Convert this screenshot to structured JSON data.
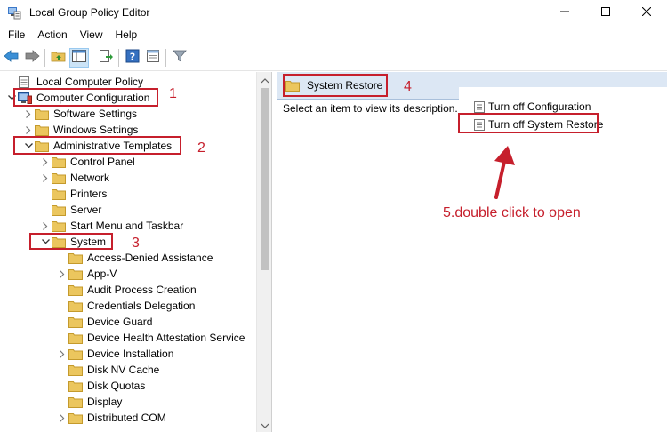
{
  "window": {
    "title": "Local Group Policy Editor",
    "app_icon": "group-policy-icon",
    "controls": [
      "minimize-icon",
      "maximize-icon",
      "close-icon"
    ]
  },
  "menubar": {
    "items": [
      {
        "label": "File"
      },
      {
        "label": "Action"
      },
      {
        "label": "View"
      },
      {
        "label": "Help"
      }
    ]
  },
  "toolbar": {
    "buttons": [
      "back-arrow-icon",
      "forward-arrow-icon",
      "up-folder-icon",
      "show-hide-tree-icon",
      "export-list-icon",
      "help-icon",
      "properties-icon",
      "filter-icon"
    ]
  },
  "tree": {
    "items": [
      {
        "label": "Local Computer Policy",
        "level": 0,
        "expander": "",
        "icon": "policy-root-icon"
      },
      {
        "label": "Computer Configuration",
        "level": 0,
        "expander": "expanded",
        "icon": "computer-icon"
      },
      {
        "label": "Software Settings",
        "level": 1,
        "expander": "collapsed",
        "icon": "folder-icon"
      },
      {
        "label": "Windows Settings",
        "level": 1,
        "expander": "collapsed",
        "icon": "folder-icon"
      },
      {
        "label": "Administrative Templates",
        "level": 1,
        "expander": "expanded",
        "icon": "folder-icon"
      },
      {
        "label": "Control Panel",
        "level": 2,
        "expander": "collapsed",
        "icon": "folder-icon"
      },
      {
        "label": "Network",
        "level": 2,
        "expander": "collapsed",
        "icon": "folder-icon"
      },
      {
        "label": "Printers",
        "level": 2,
        "expander": "",
        "icon": "folder-icon"
      },
      {
        "label": "Server",
        "level": 2,
        "expander": "",
        "icon": "folder-icon"
      },
      {
        "label": "Start Menu and Taskbar",
        "level": 2,
        "expander": "collapsed",
        "icon": "folder-icon"
      },
      {
        "label": "System",
        "level": 2,
        "expander": "expanded",
        "icon": "folder-icon"
      },
      {
        "label": "Access-Denied Assistance",
        "level": 3,
        "expander": "",
        "icon": "folder-icon"
      },
      {
        "label": "App-V",
        "level": 3,
        "expander": "collapsed",
        "icon": "folder-icon"
      },
      {
        "label": "Audit Process Creation",
        "level": 3,
        "expander": "",
        "icon": "folder-icon"
      },
      {
        "label": "Credentials Delegation",
        "level": 3,
        "expander": "",
        "icon": "folder-icon"
      },
      {
        "label": "Device Guard",
        "level": 3,
        "expander": "",
        "icon": "folder-icon"
      },
      {
        "label": "Device Health Attestation Service",
        "level": 3,
        "expander": "",
        "icon": "folder-icon"
      },
      {
        "label": "Device Installation",
        "level": 3,
        "expander": "collapsed",
        "icon": "folder-icon"
      },
      {
        "label": "Disk NV Cache",
        "level": 3,
        "expander": "",
        "icon": "folder-icon"
      },
      {
        "label": "Disk Quotas",
        "level": 3,
        "expander": "",
        "icon": "folder-icon"
      },
      {
        "label": "Display",
        "level": 3,
        "expander": "",
        "icon": "folder-icon"
      },
      {
        "label": "Distributed COM",
        "level": 3,
        "expander": "collapsed",
        "icon": "folder-icon"
      }
    ]
  },
  "right_pane": {
    "header": "System Restore",
    "description": "Select an item to view its description.",
    "policies": [
      {
        "label": "Turn off Configuration",
        "icon": "policy-setting-icon"
      },
      {
        "label": "Turn off System Restore",
        "icon": "policy-setting-icon"
      }
    ]
  },
  "annotations": {
    "color": "#c61f2c",
    "numbers": [
      "1",
      "2",
      "3",
      "4"
    ],
    "step5": "5.double click to open"
  },
  "colors": {
    "header_bg": "#dce7f4",
    "folder": "#e8c25a",
    "accent_red": "#c61f2c"
  }
}
